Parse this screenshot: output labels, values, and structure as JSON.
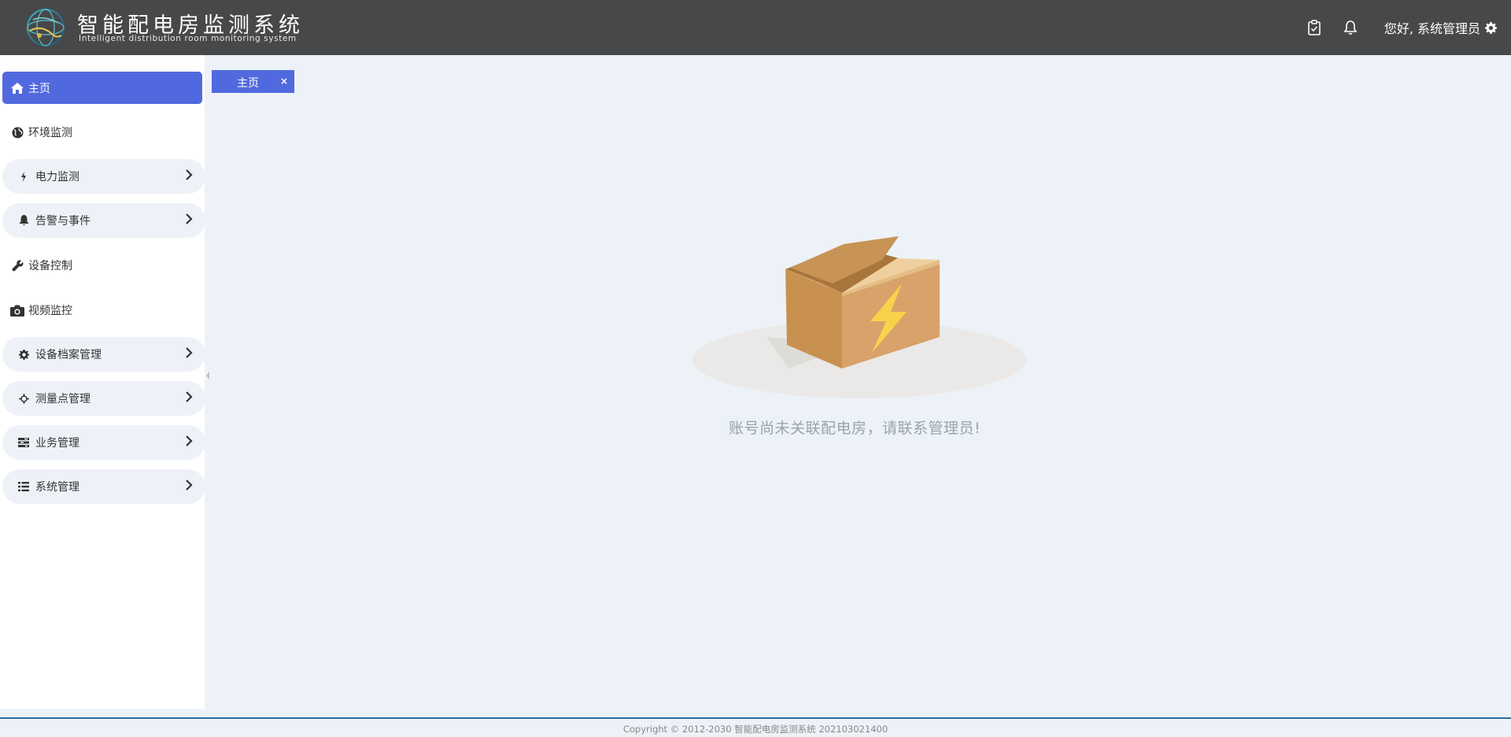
{
  "header": {
    "title": "智能配电房监测系统",
    "subtitle": "Intelligent distribution room monitoring system",
    "greeting": "您好, 系统管理员",
    "icons": [
      "clipboard-check-icon",
      "bell-icon",
      "gear-icon"
    ]
  },
  "sidebar": {
    "items": [
      {
        "label": "主页",
        "icon": "home-icon",
        "active": true,
        "has_children": false
      },
      {
        "label": "环境监测",
        "icon": "globe-icon",
        "active": false,
        "has_children": false
      },
      {
        "label": "电力监测",
        "icon": "bolt-icon",
        "active": false,
        "has_children": true
      },
      {
        "label": "告警与事件",
        "icon": "bell-icon",
        "active": false,
        "has_children": true
      },
      {
        "label": "设备控制",
        "icon": "wrench-icon",
        "active": false,
        "has_children": false
      },
      {
        "label": "视频监控",
        "icon": "camera-icon",
        "active": false,
        "has_children": false
      },
      {
        "label": "设备档案管理",
        "icon": "cog-icon",
        "active": false,
        "has_children": true
      },
      {
        "label": "测量点管理",
        "icon": "crosshair-icon",
        "active": false,
        "has_children": true
      },
      {
        "label": "业务管理",
        "icon": "tasks-icon",
        "active": false,
        "has_children": true
      },
      {
        "label": "系统管理",
        "icon": "list-icon",
        "active": false,
        "has_children": true
      }
    ]
  },
  "tabs": [
    {
      "label": "主页",
      "close": "×"
    }
  ],
  "main": {
    "empty_message": "账号尚未关联配电房，请联系管理员!"
  },
  "footer": {
    "copyright": "Copyright © 2012-2030 智能配电房监测系统 202103021400"
  },
  "colors": {
    "header_bg": "#474849",
    "accent": "#5169de",
    "page_bg": "#edf2f8",
    "footer_line": "#2a6fa8"
  }
}
